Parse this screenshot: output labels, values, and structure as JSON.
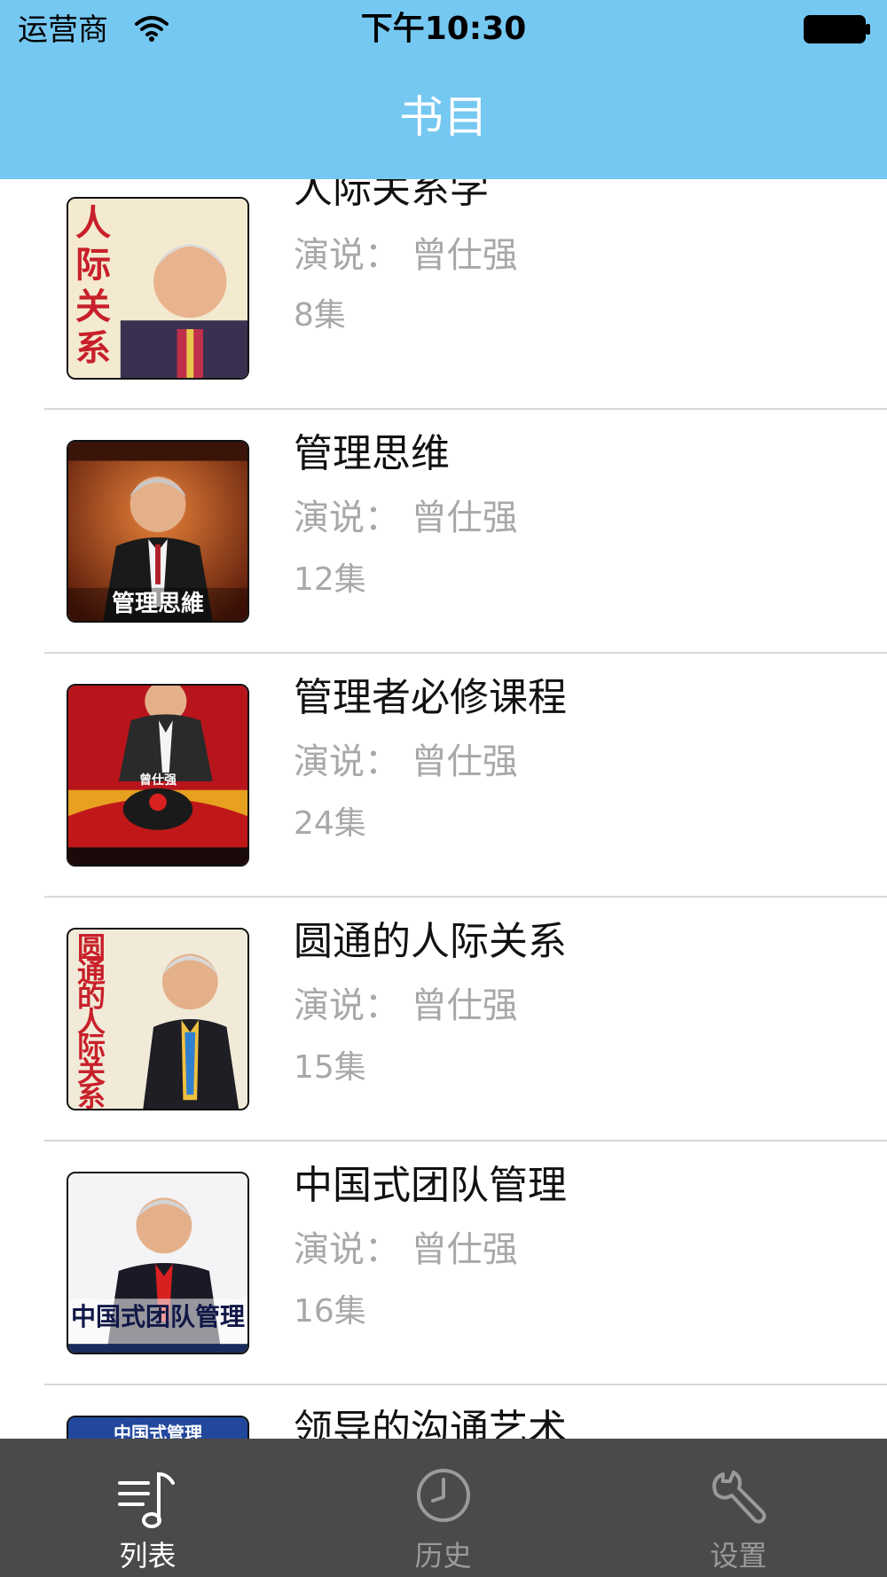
{
  "status_bar": {
    "carrier": "运营商",
    "time": "下午10:30"
  },
  "nav": {
    "title": "书目"
  },
  "books": [
    {
      "title": "人际关系学",
      "speaker": "演说：  曾仕强",
      "episodes": "8集",
      "cover_caption": "人际关系"
    },
    {
      "title": "管理思维",
      "speaker": "演说：  曾仕强",
      "episodes": "12集",
      "cover_caption": "管理思維"
    },
    {
      "title": "管理者必修课程",
      "speaker": "演说：  曾仕强",
      "episodes": "24集",
      "cover_caption": "曾仕强"
    },
    {
      "title": "圆通的人际关系",
      "speaker": "演说：  曾仕强",
      "episodes": "15集",
      "cover_caption": "圆通的人际关系"
    },
    {
      "title": "中国式团队管理",
      "speaker": "演说：  曾仕强",
      "episodes": "16集",
      "cover_caption": "中国式团队管理"
    },
    {
      "title": "领导的沟通艺术",
      "speaker": "",
      "episodes": "",
      "cover_caption": "中国式管理"
    }
  ],
  "tabs": [
    {
      "label": "列表",
      "icon": "music-list-icon",
      "active": true
    },
    {
      "label": "历史",
      "icon": "clock-icon",
      "active": false
    },
    {
      "label": "设置",
      "icon": "wrench-icon",
      "active": false
    }
  ],
  "colors": {
    "nav_bg": "#75c8f1",
    "tab_bg": "#4a4a4a",
    "tab_active": "#ffffff",
    "tab_inactive": "#9a9a9a",
    "secondary_text": "#a8a8a8"
  }
}
